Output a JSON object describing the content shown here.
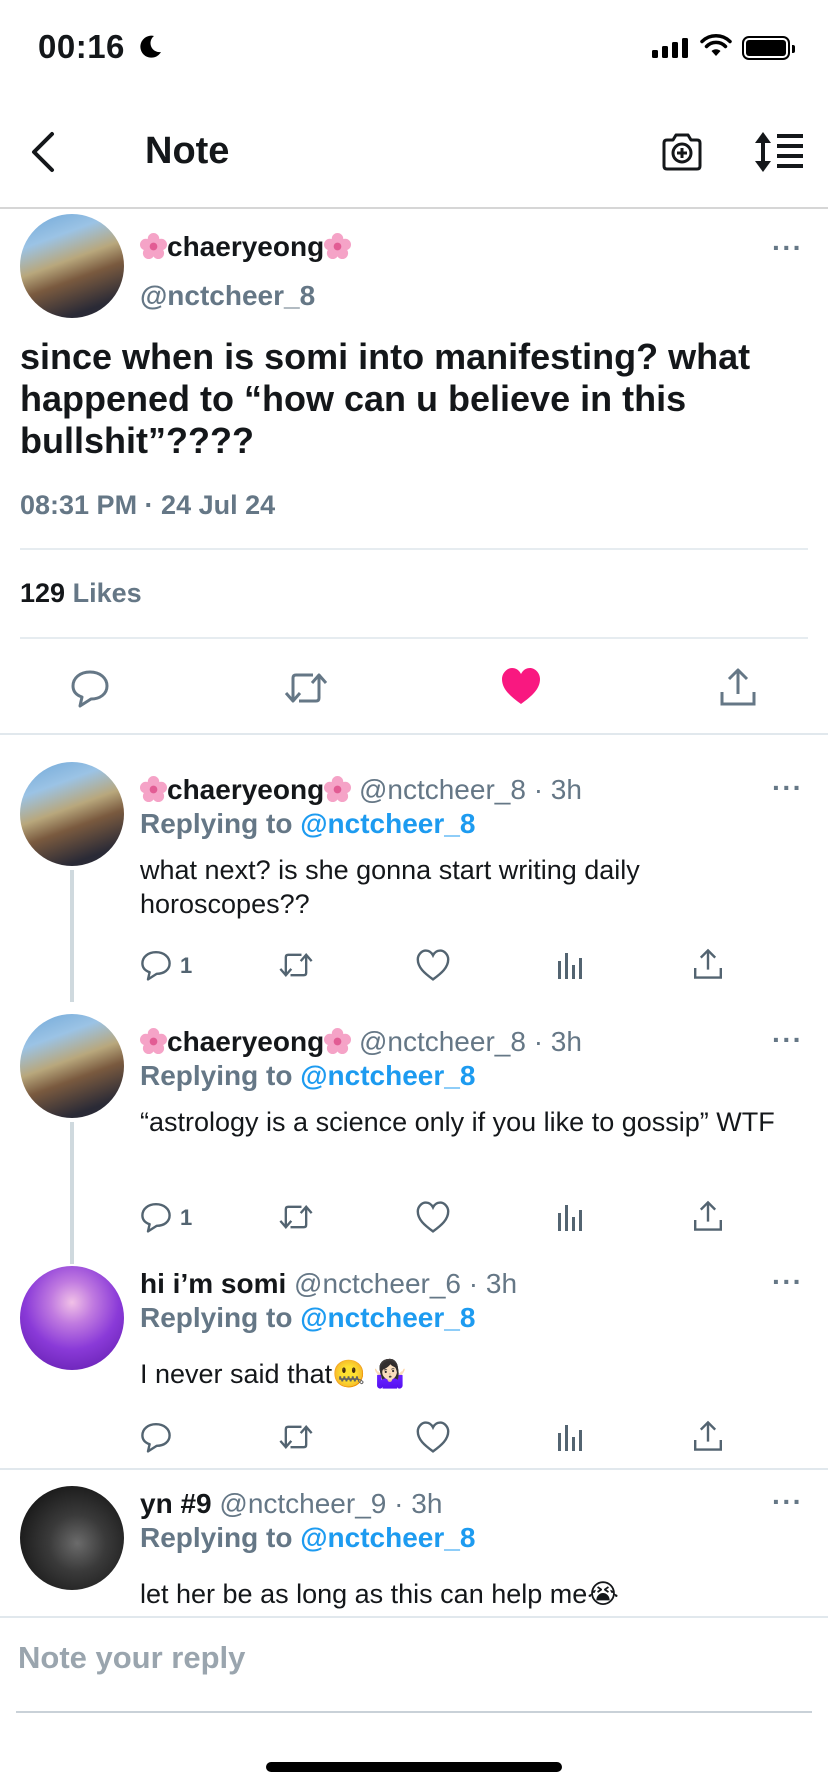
{
  "status_bar": {
    "time": "00:16"
  },
  "nav": {
    "title": "Note"
  },
  "main_tweet": {
    "display_name": "chaeryeong",
    "handle": "@nctcheer_8",
    "text": "since when is somi into manifesting? what happened to “how can u believe in this bullshit”????",
    "timestamp": "08:31 PM · 24 Jul 24",
    "likes_count": "129",
    "likes_label": "Likes",
    "liked": true,
    "more": "···"
  },
  "replies": [
    {
      "display_name": "chaeryeong",
      "handle": "@nctcheer_8",
      "time": "· 3h",
      "replying_prefix": "Replying to",
      "replying_to": "@nctcheer_8",
      "text": "what next? is she gonna start writing daily horoscopes??",
      "reply_count": "1",
      "more": "···"
    },
    {
      "display_name": "chaeryeong",
      "handle": "@nctcheer_8",
      "time": "· 3h",
      "replying_prefix": "Replying to",
      "replying_to": "@nctcheer_8",
      "text": "“astrology is a science only if you like to gossip” WTF",
      "reply_count": "1",
      "more": "···"
    },
    {
      "display_name": "hi i’m somi",
      "handle": "@nctcheer_6",
      "time": "· 3h",
      "replying_prefix": "Replying to",
      "replying_to": "@nctcheer_8",
      "text": "I never said that🤐 🤷🏻‍♀️",
      "more": "···"
    },
    {
      "display_name": "yn #9",
      "handle": "@nctcheer_9",
      "time": "· 3h",
      "replying_prefix": "Replying to",
      "replying_to": "@nctcheer_8",
      "text": "let her be as long as this can help me😭",
      "more": "···"
    }
  ],
  "reply_box": {
    "placeholder": "Note your reply"
  },
  "colors": {
    "like_red": "#f91880",
    "link_blue": "#1d9bf0",
    "secondary_gray": "#657786"
  }
}
